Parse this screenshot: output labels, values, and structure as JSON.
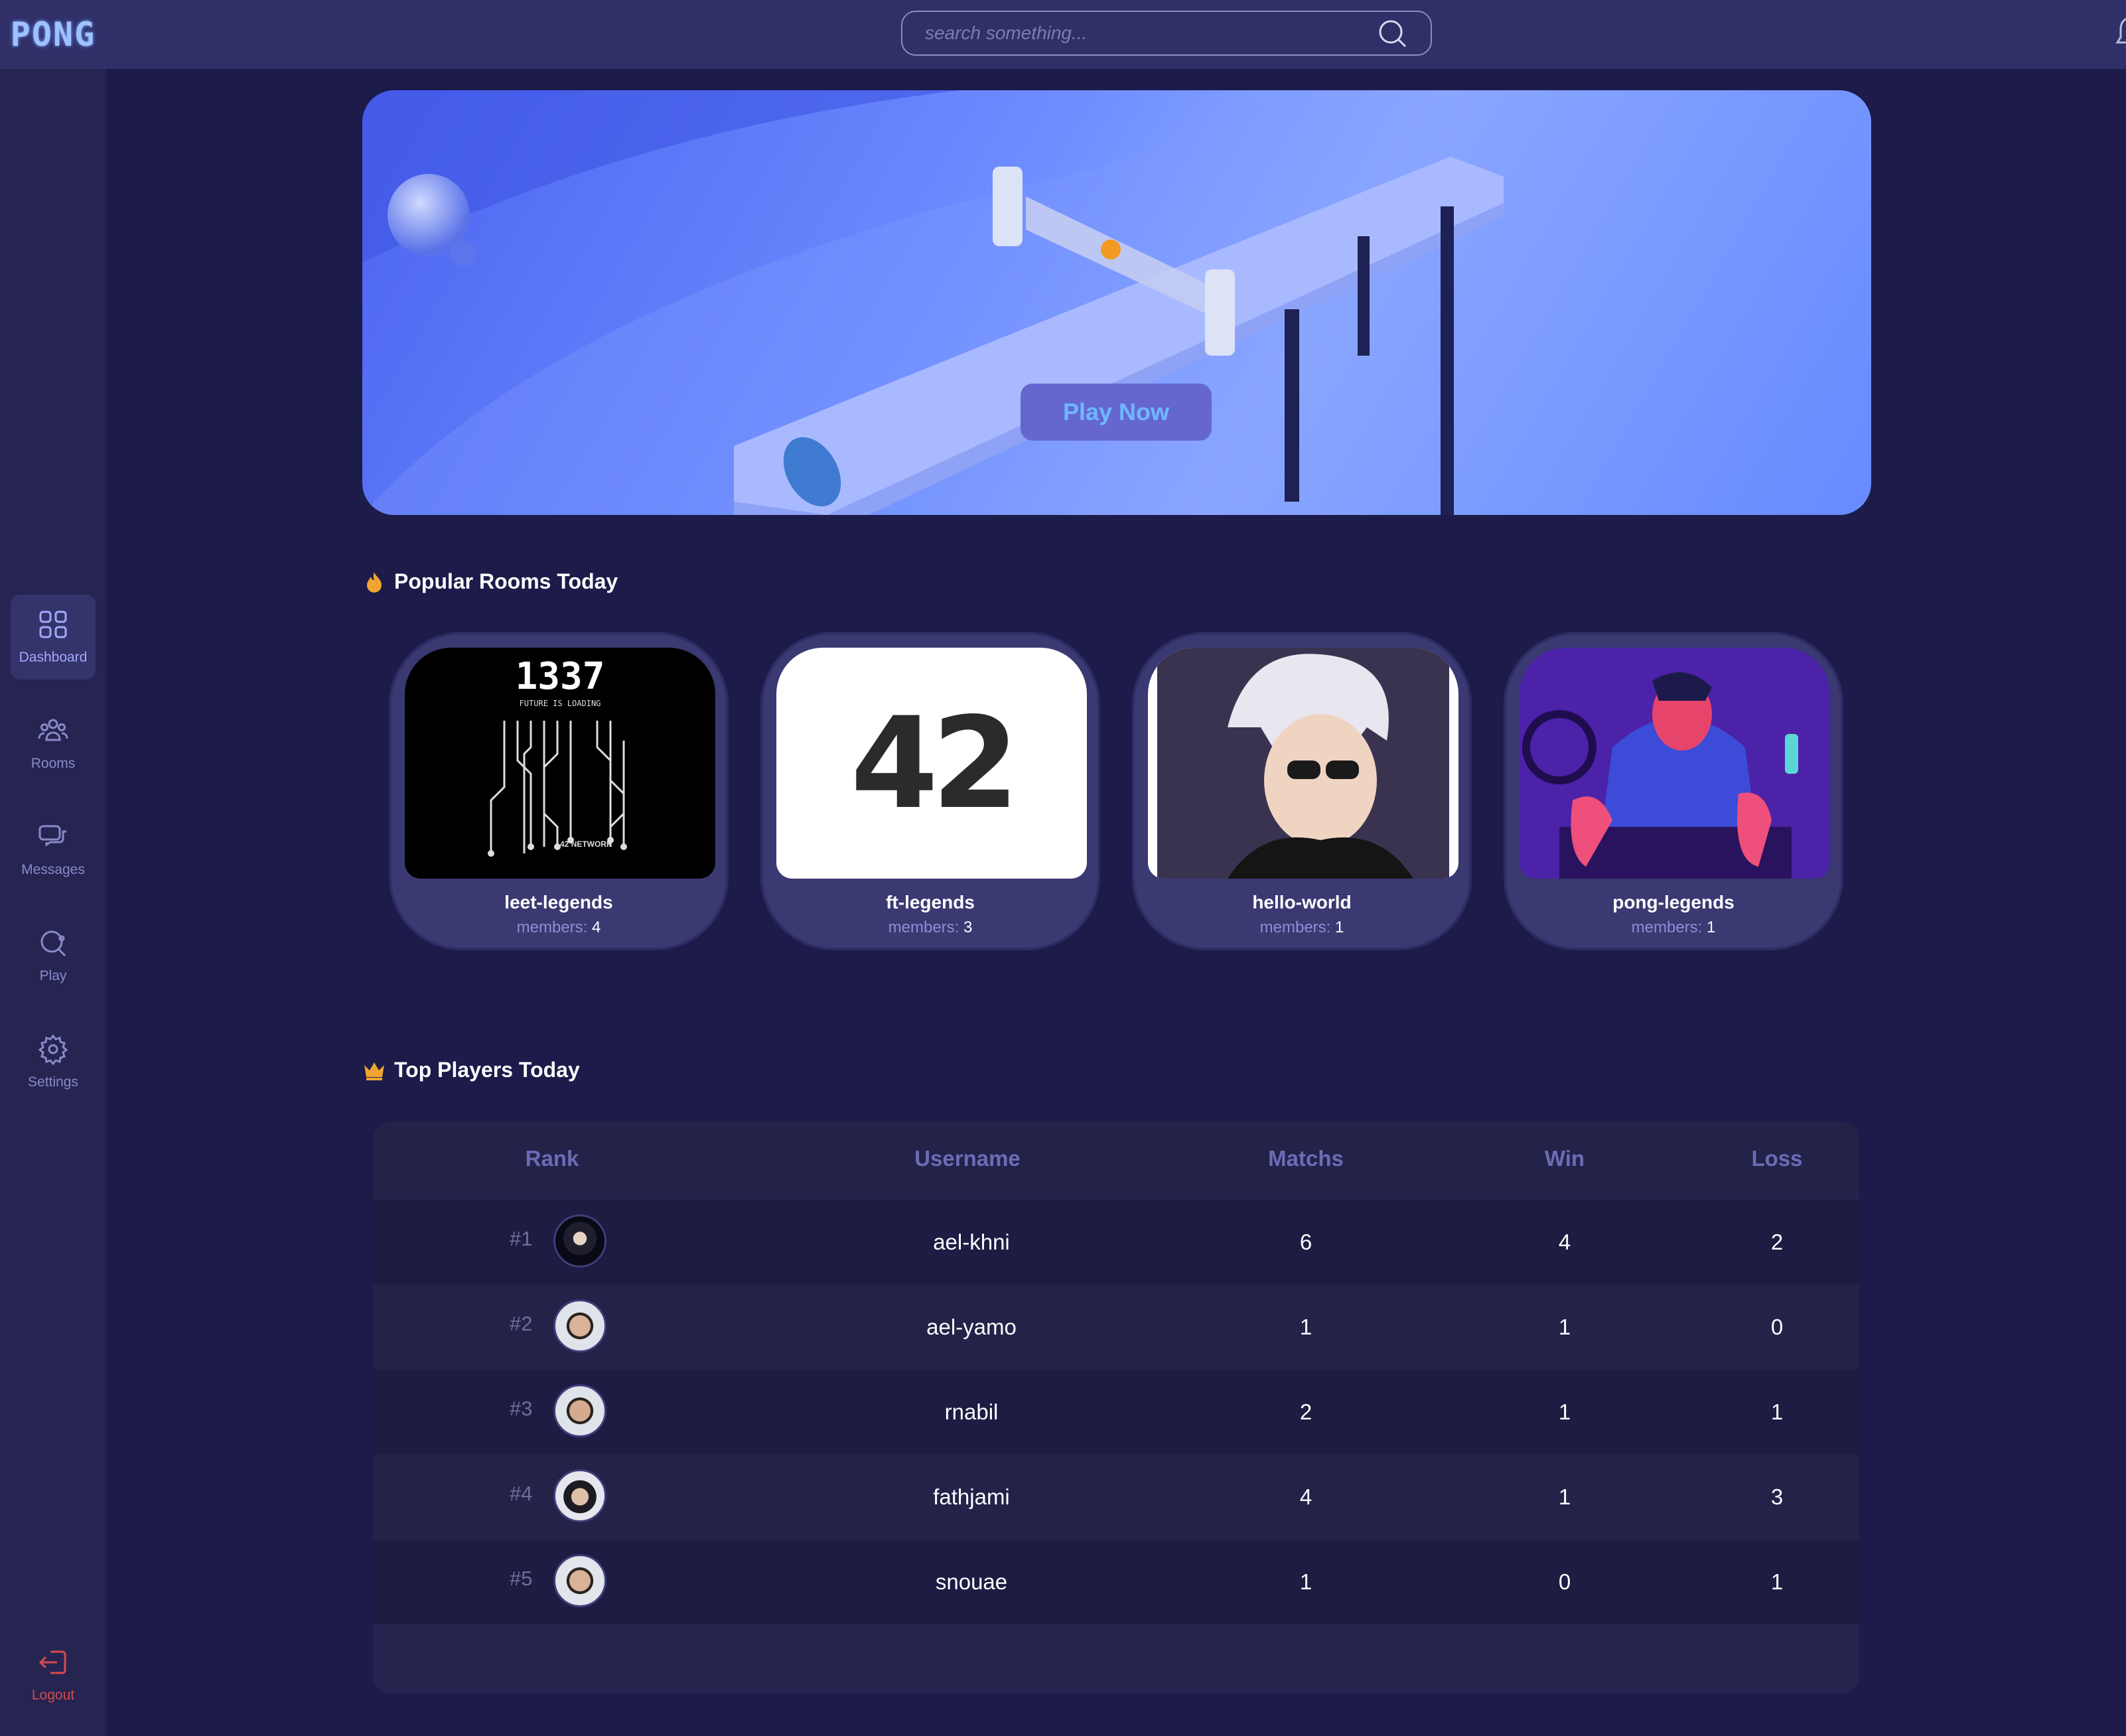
{
  "app": {
    "logo_text": "PONG"
  },
  "sidebar": {
    "items": [
      {
        "label": "Dashboard",
        "icon": "grid-icon",
        "active": true
      },
      {
        "label": "Rooms",
        "icon": "users-icon"
      },
      {
        "label": "Messages",
        "icon": "chat-icon"
      },
      {
        "label": "Play",
        "icon": "paddle-icon"
      },
      {
        "label": "Settings",
        "icon": "gear-icon"
      }
    ],
    "logout_label": "Logout"
  },
  "search": {
    "placeholder": "search something..."
  },
  "hero": {
    "play_label": "Play Now"
  },
  "rooms_section": {
    "title": "Popular Rooms Today",
    "icon": "flame-icon"
  },
  "rooms": [
    {
      "name": "leet-legends",
      "members_label": "members:",
      "members": "4"
    },
    {
      "name": "ft-legends",
      "members_label": "members:",
      "members": "3"
    },
    {
      "name": "hello-world",
      "members_label": "members:",
      "members": "1"
    },
    {
      "name": "pong-legends",
      "members_label": "members:",
      "members": "1"
    }
  ],
  "room_images": {
    "leet_title": "1337",
    "leet_tagline": "FUTURE IS LOADING",
    "leet_network": "42 NETWORK",
    "ft_logo": "42"
  },
  "players_section": {
    "title": "Top Players Today",
    "icon": "crown-icon"
  },
  "table": {
    "headers": [
      "Rank",
      "Username",
      "Matchs",
      "Win",
      "Loss"
    ],
    "rows": [
      {
        "rank": "#1",
        "username": "ael-khni",
        "matchs": "6",
        "win": "4",
        "loss": "2"
      },
      {
        "rank": "#2",
        "username": "ael-yamo",
        "matchs": "1",
        "win": "1",
        "loss": "0"
      },
      {
        "rank": "#3",
        "username": "rnabil",
        "matchs": "2",
        "win": "1",
        "loss": "1"
      },
      {
        "rank": "#4",
        "username": "fathjami",
        "matchs": "4",
        "win": "1",
        "loss": "3"
      },
      {
        "rank": "#5",
        "username": "snouae",
        "matchs": "1",
        "win": "0",
        "loss": "1"
      }
    ]
  },
  "colors": {
    "background": "#1c1b49",
    "sidebar": "#262552",
    "topbar": "#302f68",
    "accent": "#a3a9ff",
    "logout": "#d84a4a",
    "gold": "#f0a531"
  }
}
